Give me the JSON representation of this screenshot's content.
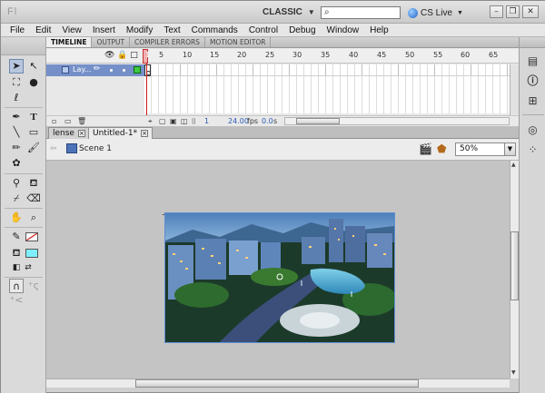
{
  "titlebar": {
    "logo": "Fl",
    "workspace": "CLASSIC",
    "search_placeholder": "",
    "cs_live": "CS Live",
    "minimize": "–",
    "restore": "❐",
    "close": "✕"
  },
  "menu": [
    "File",
    "Edit",
    "View",
    "Insert",
    "Modify",
    "Text",
    "Commands",
    "Control",
    "Debug",
    "Window",
    "Help"
  ],
  "timeline": {
    "tabs": [
      "TIMELINE",
      "OUTPUT",
      "COMPILER ERRORS",
      "MOTION EDITOR"
    ],
    "layer_name": "Lay...",
    "ruler": [
      "5",
      "10",
      "15",
      "20",
      "25",
      "30",
      "35",
      "40",
      "45",
      "50",
      "55",
      "60",
      "65"
    ],
    "current_frame": "1",
    "fps": "24.00",
    "fps_label": "fps",
    "time": "0.0",
    "time_label": "s"
  },
  "doc_tabs": [
    "lense",
    "Untitled-1*"
  ],
  "editbar": {
    "scene": "Scene 1",
    "zoom": "50%"
  },
  "colors": {
    "stroke": "#d23a3a",
    "fill": "#7fefff",
    "layer_selected": "#7590c8",
    "playhead": "#d01e1e"
  }
}
